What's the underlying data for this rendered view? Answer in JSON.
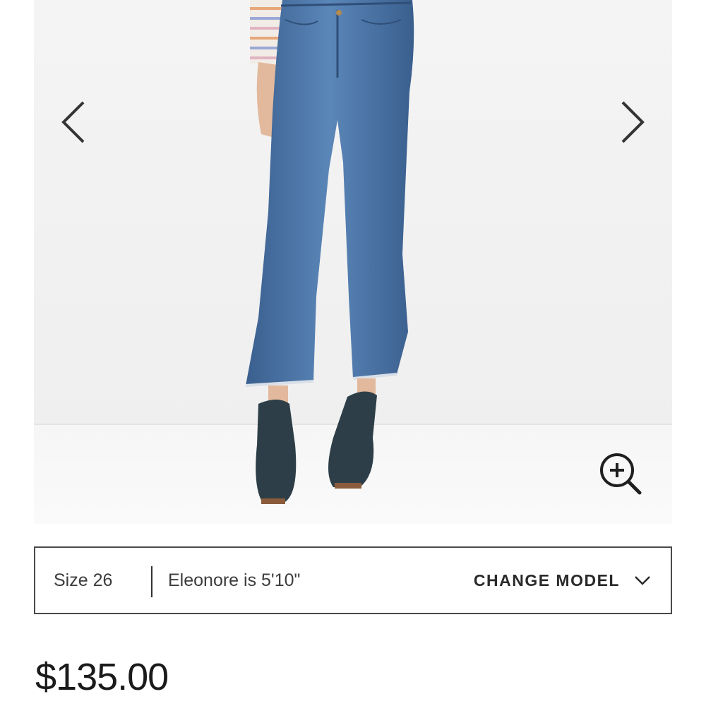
{
  "carousel": {
    "image_alt": "Model wearing cropped flare jeans with ankle boots",
    "prev_icon": "chevron-left-icon",
    "next_icon": "chevron-right-icon",
    "zoom_icon": "zoom-in-icon"
  },
  "model_info": {
    "size": "Size 26",
    "model_height": "Eleonore is 5'10\"",
    "change_label": "CHANGE MODEL",
    "change_icon": "chevron-down-icon"
  },
  "product": {
    "price": "$135.00"
  },
  "colors": {
    "denim": "#3f6a9e",
    "boots": "#2d3e48",
    "text": "#2a2a2a",
    "border": "#4a4a4a"
  }
}
